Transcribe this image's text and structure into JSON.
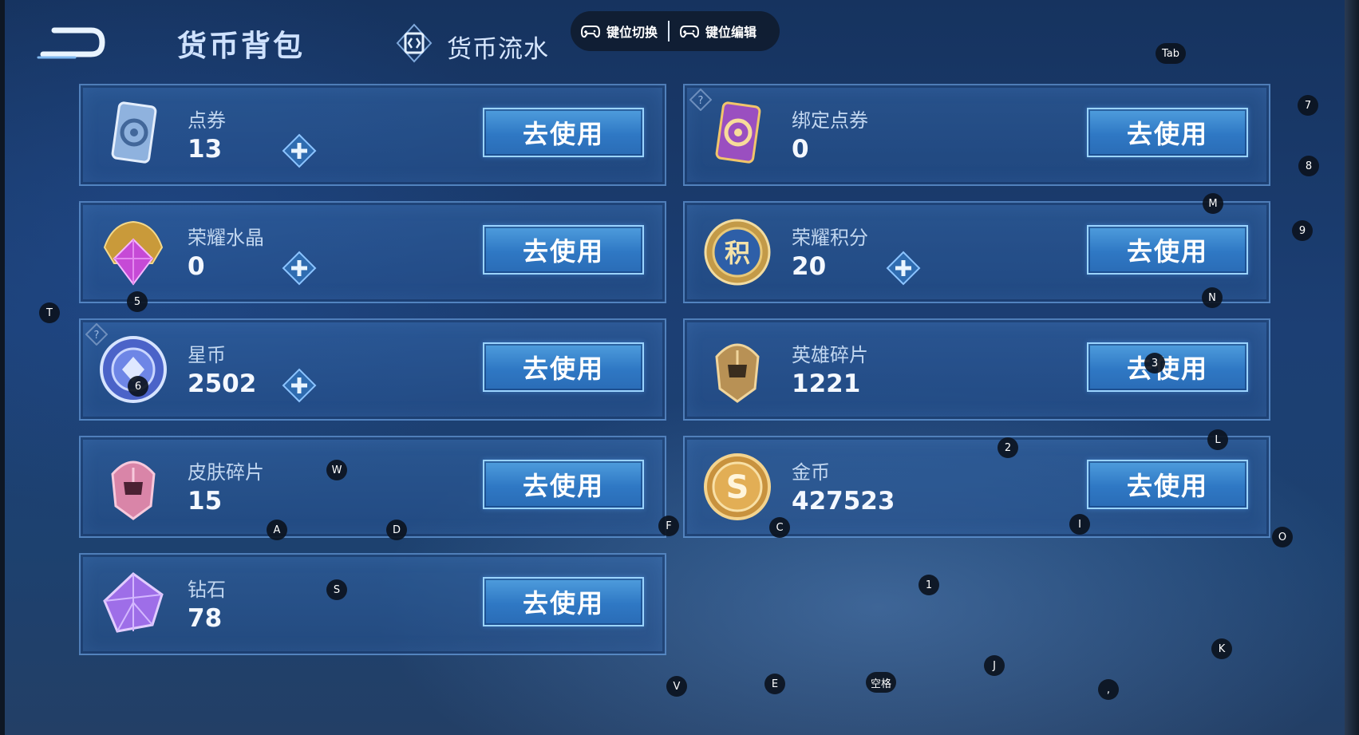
{
  "header": {
    "title": "货币背包",
    "flow_label": "货币流水",
    "key_switch_label": "键位切换",
    "key_edit_label": "键位编辑"
  },
  "currencies": [
    {
      "name": "点券",
      "amount": "13",
      "button": "去使用",
      "icon": "voucher-blue-icon",
      "has_plus": true
    },
    {
      "name": "绑定点券",
      "amount": "0",
      "button": "去使用",
      "icon": "voucher-purple-icon",
      "has_plus": false
    },
    {
      "name": "荣耀水晶",
      "amount": "0",
      "button": "去使用",
      "icon": "glory-crystal-icon",
      "has_plus": true
    },
    {
      "name": "荣耀积分",
      "amount": "20",
      "button": "去使用",
      "icon": "glory-points-icon",
      "has_plus": true
    },
    {
      "name": "星币",
      "amount": "2502",
      "button": "去使用",
      "icon": "star-coin-icon",
      "has_plus": true
    },
    {
      "name": "英雄碎片",
      "amount": "1221",
      "button": "去使用",
      "icon": "hero-fragment-icon",
      "has_plus": false
    },
    {
      "name": "皮肤碎片",
      "amount": "15",
      "button": "去使用",
      "icon": "skin-fragment-icon",
      "has_plus": false
    },
    {
      "name": "金币",
      "amount": "427523",
      "button": "去使用",
      "icon": "gold-coin-icon",
      "has_plus": false
    },
    {
      "name": "钻石",
      "amount": "78",
      "button": "去使用",
      "icon": "diamond-icon",
      "has_plus": false
    }
  ],
  "key_markers": [
    "Tab",
    "7",
    "8",
    "M",
    "9",
    "N",
    "T",
    "5",
    "6",
    "3",
    "2",
    "L",
    "W",
    "A",
    "D",
    "F",
    "C",
    "I",
    "O",
    "1",
    "S",
    "K",
    "J",
    "V",
    "E",
    "空格",
    ","
  ],
  "colors": {
    "accent": "#2f78c4",
    "card_border": "#74aae6",
    "background": "#1c3f74"
  }
}
